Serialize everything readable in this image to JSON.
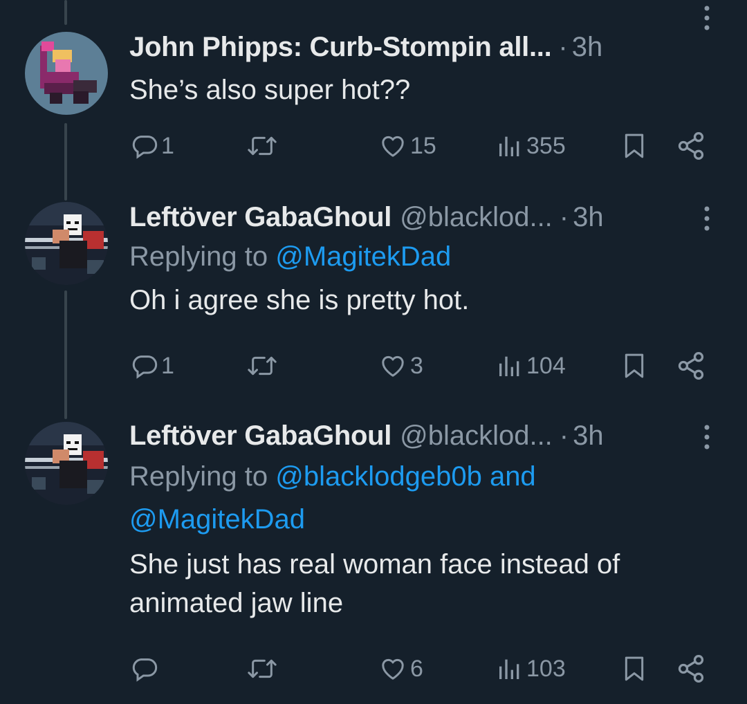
{
  "tweets": [
    {
      "name": "John Phipps: Curb-Stompin all...",
      "handle": "",
      "separator": "·",
      "time": "3h",
      "replying_prefix": "",
      "mentions": "",
      "mentions2": "",
      "text": "She’s also super hot??",
      "replies": "1",
      "retweets": "",
      "likes": "15",
      "views": "355"
    },
    {
      "name": "Leftöver GabaGhoul",
      "handle": "@blacklod...",
      "separator": "·",
      "time": "3h",
      "replying_prefix": "Replying to ",
      "mentions": "@MagitekDad",
      "mentions2": "",
      "text": "Oh i agree she is pretty hot.",
      "replies": "1",
      "retweets": "",
      "likes": "3",
      "views": "104"
    },
    {
      "name": "Leftöver GabaGhoul",
      "handle": "@blacklod...",
      "separator": "·",
      "time": "3h",
      "replying_prefix": "Replying to ",
      "mentions": "@blacklodgeb0b and",
      "mentions2": "@MagitekDad",
      "text": "She just has real woman face instead of animated jaw line",
      "replies": "",
      "retweets": "",
      "likes": "6",
      "views": "103"
    }
  ],
  "icons": {
    "reply": "reply-icon",
    "retweet": "retweet-icon",
    "like": "heart-icon",
    "views": "views-icon",
    "bookmark": "bookmark-icon",
    "share": "share-icon",
    "more": "more-icon"
  },
  "colors": {
    "background": "#15202b",
    "text": "#e7e9ea",
    "secondary": "#8b98a5",
    "link": "#1d9bf0",
    "thread_line": "#38444d"
  }
}
